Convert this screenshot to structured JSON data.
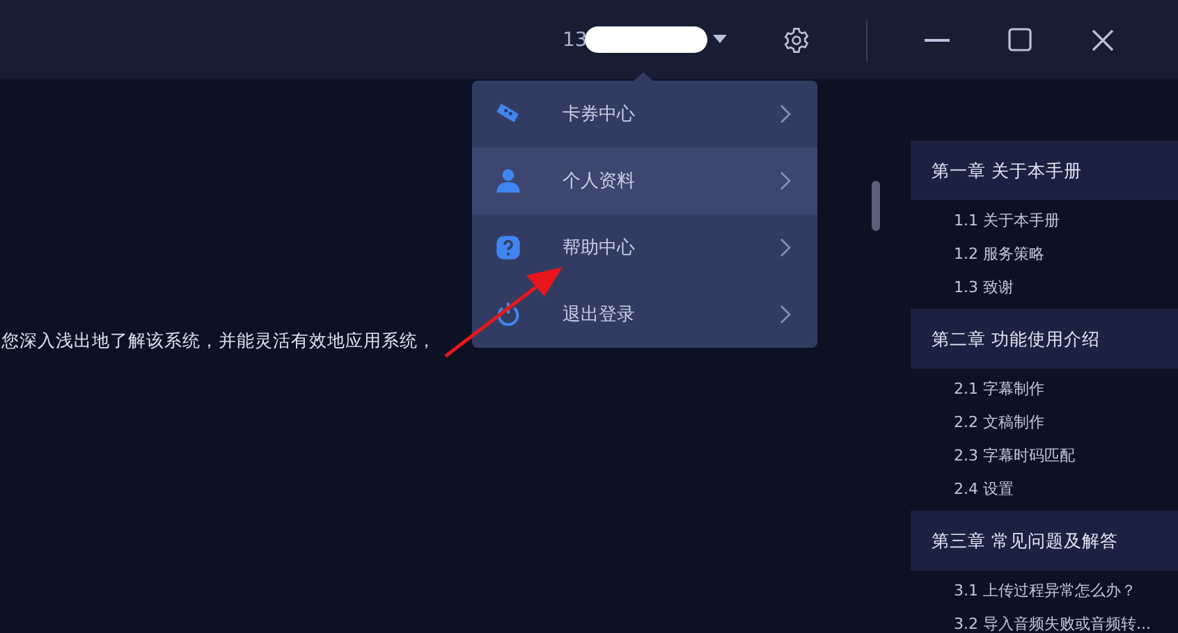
{
  "header": {
    "account": "13"
  },
  "account_menu": {
    "items": [
      {
        "label": "卡券中心",
        "kind": "ticket",
        "selected": false
      },
      {
        "label": "个人资料",
        "kind": "person",
        "selected": true
      },
      {
        "label": "帮助中心",
        "kind": "help",
        "selected": false
      },
      {
        "label": "退出登录",
        "kind": "power",
        "selected": false
      }
    ]
  },
  "content": {
    "text": "您深入浅出地了解该系统，并能灵活有效地应用系统，"
  },
  "toc": {
    "chapters": [
      {
        "title": "第一章 关于本手册",
        "children": [
          {
            "title": "1.1 关于本手册"
          },
          {
            "title": "1.2 服务策略"
          },
          {
            "title": "1.3 致谢"
          }
        ]
      },
      {
        "title": "第二章 功能使用介绍",
        "children": [
          {
            "title": "2.1 字幕制作"
          },
          {
            "title": "2.2 文稿制作"
          },
          {
            "title": "2.3 字幕时码匹配"
          },
          {
            "title": "2.4 设置"
          }
        ]
      },
      {
        "title": "第三章 常见问题及解答",
        "children": [
          {
            "title": "3.1 上传过程异常怎么办？"
          },
          {
            "title": "3.2 导入音频失败或音频转..."
          }
        ]
      }
    ]
  }
}
